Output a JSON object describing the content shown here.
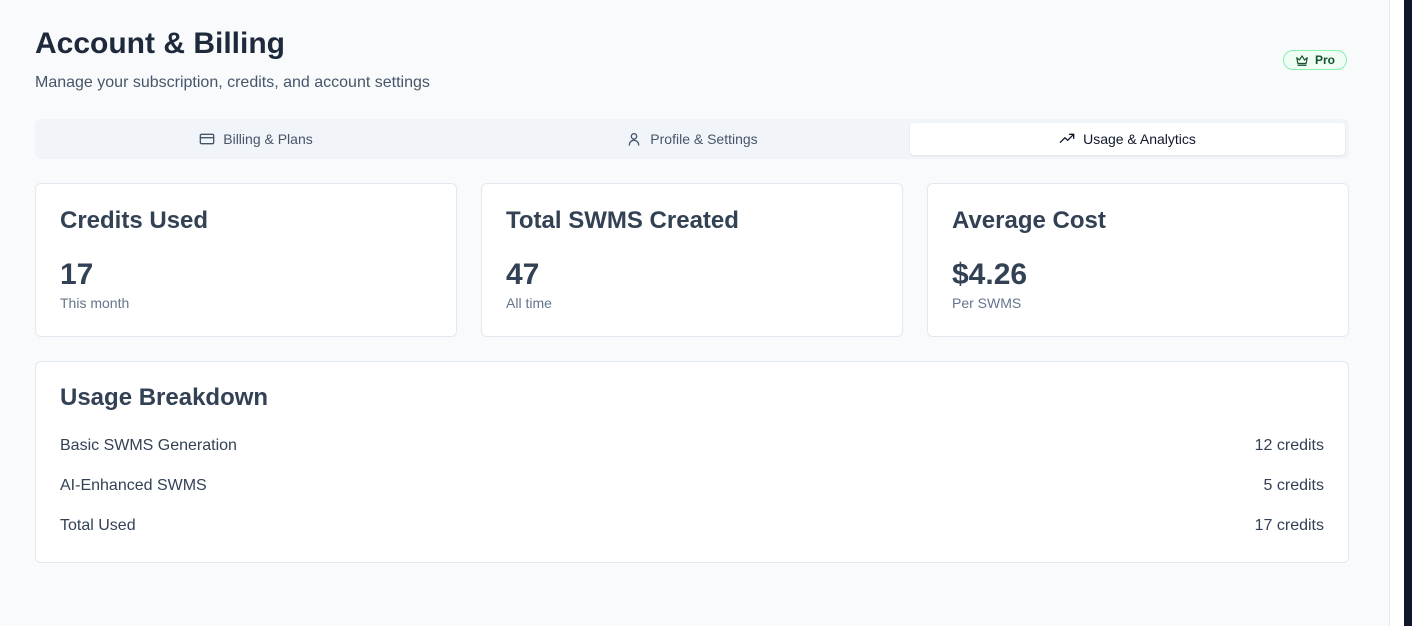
{
  "header": {
    "title": "Account & Billing",
    "subtitle": "Manage your subscription, credits, and account settings",
    "plan_badge": {
      "label": "Pro",
      "icon": "crown-icon",
      "color": "#14532d"
    }
  },
  "tabs": [
    {
      "label": "Billing & Plans",
      "icon": "credit-card-icon",
      "active": false
    },
    {
      "label": "Profile & Settings",
      "icon": "user-icon",
      "active": false
    },
    {
      "label": "Usage & Analytics",
      "icon": "trending-up-icon",
      "active": true
    }
  ],
  "stats": [
    {
      "title": "Credits Used",
      "value": "17",
      "caption": "This month"
    },
    {
      "title": "Total SWMS Created",
      "value": "47",
      "caption": "All time"
    },
    {
      "title": "Average Cost",
      "value": "$4.26",
      "caption": "Per SWMS"
    }
  ],
  "breakdown": {
    "title": "Usage Breakdown",
    "rows": [
      {
        "label": "Basic SWMS Generation",
        "value": "12 credits"
      },
      {
        "label": "AI-Enhanced SWMS",
        "value": "5 credits"
      },
      {
        "label": "Total Used",
        "value": "17 credits"
      }
    ]
  }
}
